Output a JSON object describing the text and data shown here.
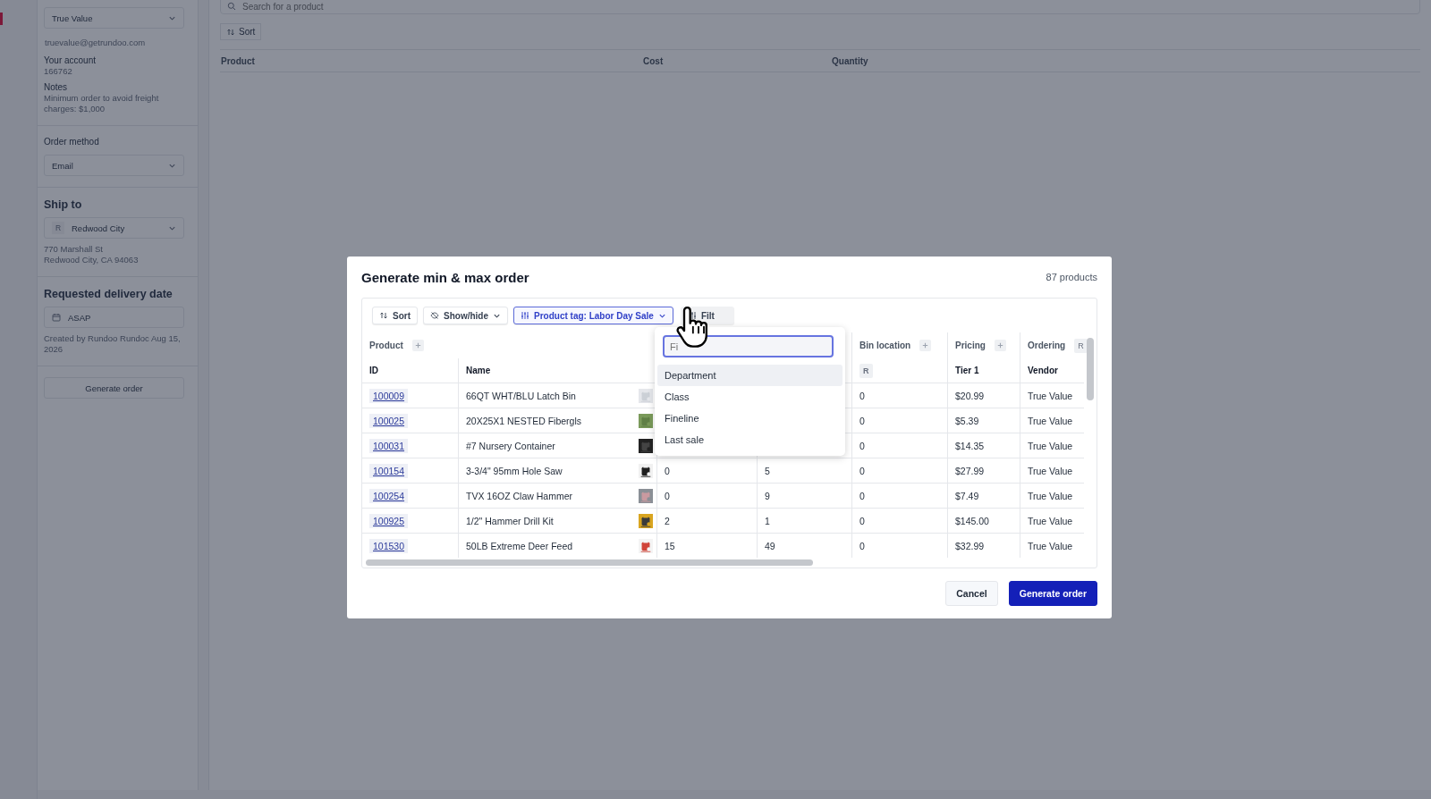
{
  "sidebar": {
    "vendor": "True Value",
    "email": "truevalue@getrundoo.com",
    "account": {
      "label": "Your account",
      "value": "166762"
    },
    "notes": {
      "label": "Notes",
      "value": "Minimum order to avoid freight charges: $1,000"
    },
    "order_method": {
      "label": "Order method",
      "value": "Email"
    },
    "ship_to": {
      "heading": "Ship to",
      "avatar": "R",
      "value": "Redwood City",
      "address": [
        "770 Marshall St",
        "Redwood City, CA 94063"
      ]
    },
    "delivery": {
      "heading": "Requested delivery date",
      "value": "ASAP",
      "created": "Created by Rundoo Rundoc Aug 15, 2026"
    },
    "button": "Generate order"
  },
  "main": {
    "search": {
      "placeholder": "Search for a product"
    },
    "sort": "Sort",
    "columns": [
      "Product",
      "Cost",
      "Quantity"
    ]
  },
  "dialog": {
    "title": "Generate min & max order",
    "count": "87 products",
    "toolbar": [
      {
        "kind": "sort",
        "label": "Sort"
      },
      {
        "kind": "toggle",
        "label": "Show/hide"
      },
      {
        "kind": "active_filter",
        "label": "Product tag: Labor Day Sale"
      },
      {
        "kind": "filter",
        "label": "Filt"
      }
    ],
    "columns": [
      {
        "kind": "link",
        "group": "Product",
        "group_add": true,
        "header": "ID"
      },
      {
        "kind": "product",
        "header": "Name"
      },
      {
        "kind": "number"
      },
      {
        "kind": "number"
      },
      {
        "kind": "number",
        "group": "Bin location",
        "group_add": true,
        "header_chip": "R"
      },
      {
        "kind": "number",
        "group": "Pricing",
        "group_add": true,
        "header": "Tier 1"
      },
      {
        "kind": "number",
        "group": "Ordering",
        "group_chip": "R",
        "header": "Vendor"
      }
    ],
    "rows": [
      {
        "cells": [
          "100009",
          "66QT WHT/BLU Latch Bin",
          null,
          null,
          "0",
          "$20.99",
          "True Value"
        ]
      },
      {
        "cells": [
          "100025",
          "20X25X1 NESTED Fibergls",
          null,
          null,
          "0",
          "$5.39",
          "True Value"
        ]
      },
      {
        "cells": [
          "100031",
          "#7 Nursery Container",
          null,
          null,
          "0",
          "$14.35",
          "True Value"
        ]
      },
      {
        "cells": [
          "100154",
          "3-3/4\" 95mm Hole Saw",
          "0",
          "5",
          "0",
          "$27.99",
          "True Value"
        ]
      },
      {
        "cells": [
          "100254",
          "TVX 16OZ Claw Hammer",
          "0",
          "9",
          "0",
          "$7.49",
          "True Value"
        ]
      },
      {
        "cells": [
          "100925",
          "1/2\" Hammer Drill Kit",
          "2",
          "1",
          "0",
          "$145.00",
          "True Value"
        ]
      },
      {
        "cells": [
          "101530",
          "50LB Extreme Deer Feed",
          "15",
          "49",
          "0",
          "$32.99",
          "True Value"
        ]
      }
    ],
    "filter_menu": {
      "placeholder": "Fi",
      "options": [
        {
          "label": "Department",
          "highlighted": true
        },
        {
          "label": "Class",
          "highlighted": false
        },
        {
          "label": "Fineline",
          "highlighted": false
        },
        {
          "label": "Last sale",
          "highlighted": false
        }
      ]
    },
    "buttons": [
      {
        "kind": "secondary",
        "label": "Cancel"
      },
      {
        "kind": "primary",
        "label": "Generate order"
      }
    ]
  }
}
